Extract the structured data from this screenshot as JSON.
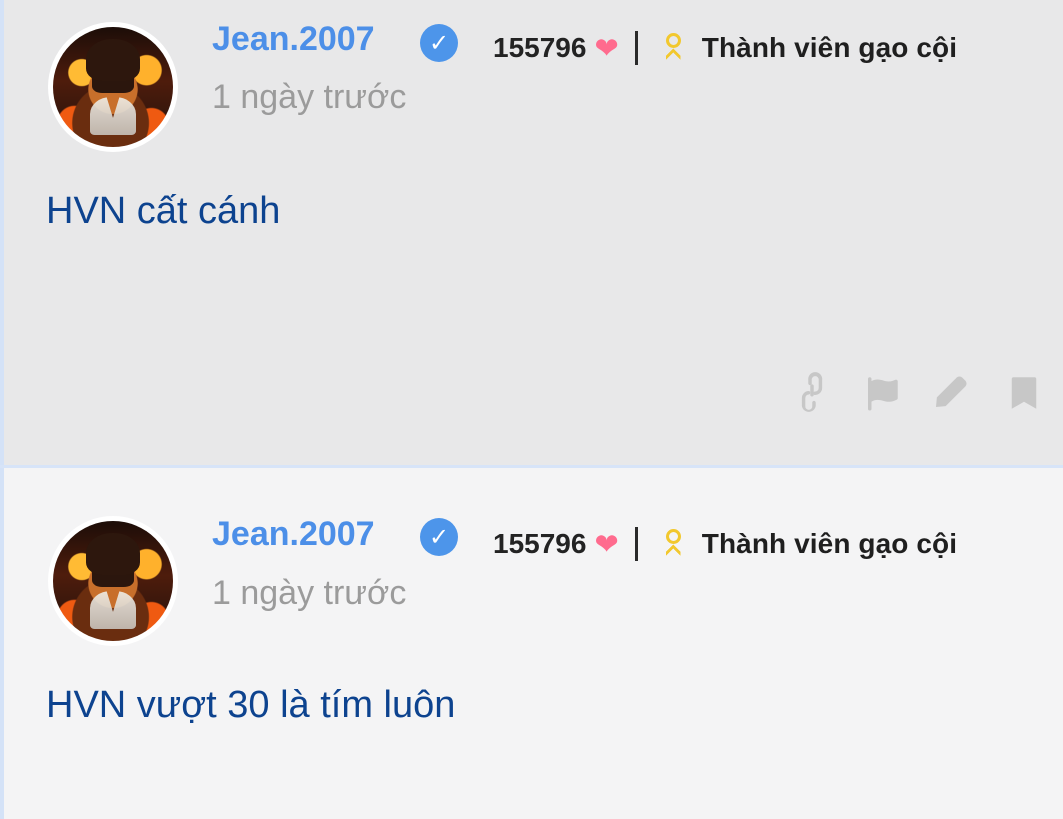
{
  "posts": [
    {
      "author": "Jean.2007",
      "time": "1 ngày trước",
      "likes": "155796",
      "rank": "Thành viên gạo cội",
      "content": "HVN cất cánh"
    },
    {
      "author": "Jean.2007",
      "time": "1 ngày trước",
      "likes": "155796",
      "rank": "Thành viên gạo cội",
      "content": "HVN vượt 30 là tím luôn"
    }
  ],
  "icons": {
    "verified": "verified-check-icon",
    "heart": "heart-icon",
    "award": "award-icon",
    "link": "link-icon",
    "flag": "flag-icon",
    "edit": "edit-icon",
    "bookmark": "bookmark-icon"
  },
  "colors": {
    "author": "#4c8fe8",
    "content": "#0d438f",
    "time": "#9b9b9b",
    "heart": "#ff6b8e",
    "award": "#f2c82e",
    "actions": "#c7c7c7"
  }
}
